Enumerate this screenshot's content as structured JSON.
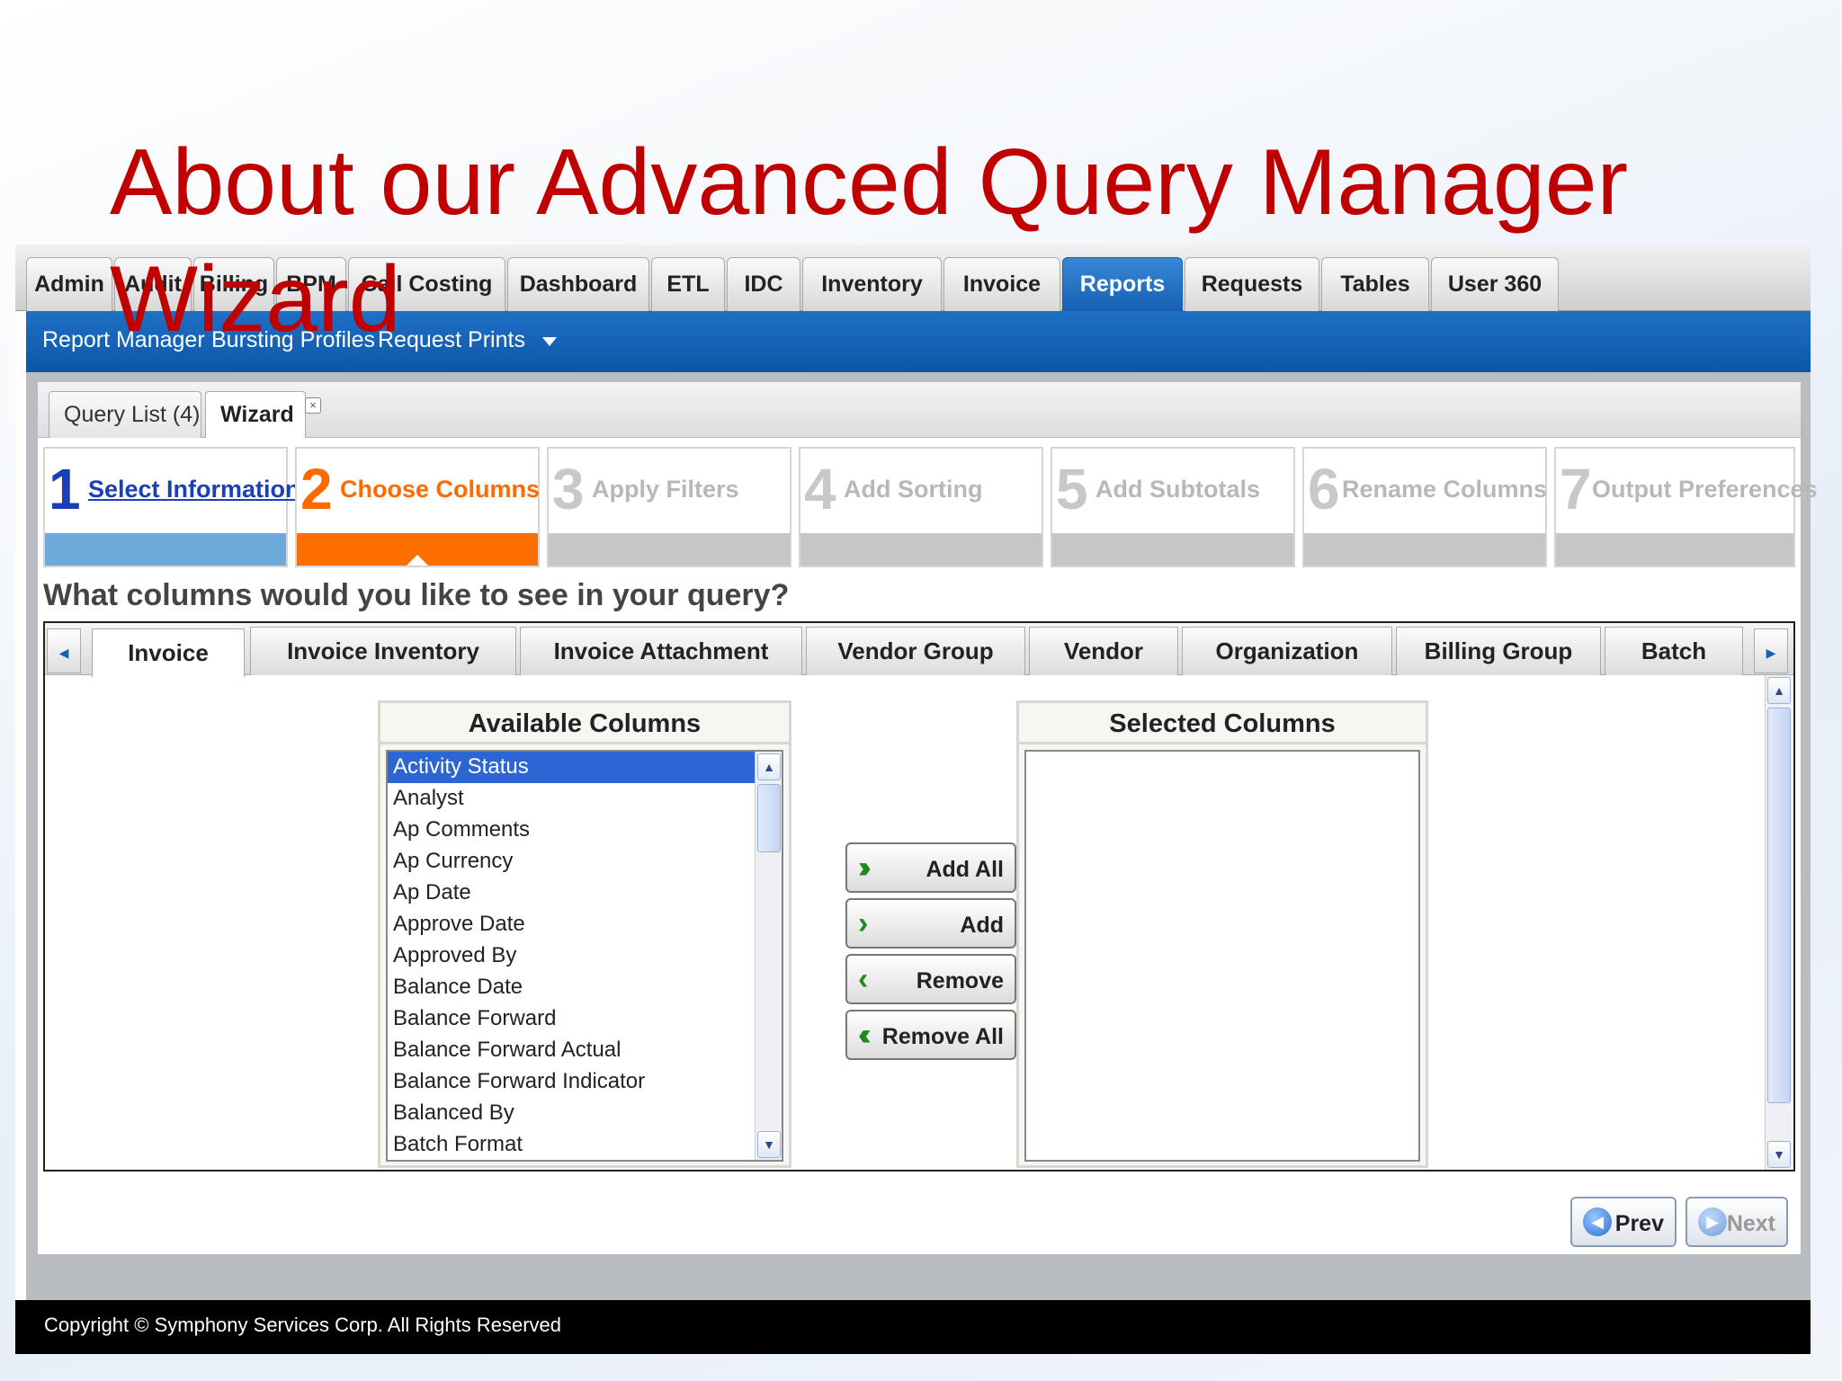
{
  "slide": {
    "title_line1": "About our Advanced Query Manager",
    "title_line2": "Wizard"
  },
  "top_tabs": [
    {
      "label": "Admin"
    },
    {
      "label": "Audit"
    },
    {
      "label": "Billing"
    },
    {
      "label": "BPM"
    },
    {
      "label": "Call Costing"
    },
    {
      "label": "Dashboard"
    },
    {
      "label": "ETL"
    },
    {
      "label": "IDC"
    },
    {
      "label": "Inventory"
    },
    {
      "label": "Invoice"
    },
    {
      "label": "Reports"
    },
    {
      "label": "Requests"
    },
    {
      "label": "Tables"
    },
    {
      "label": "User 360"
    }
  ],
  "sub_nav": [
    "Report Manager",
    "Bursting Profiles",
    "Request Prints"
  ],
  "inner_tabs": {
    "query_list": "Query List (4)",
    "wizard": "Wizard",
    "close": "×"
  },
  "steps": [
    {
      "num": "1",
      "label": "Select Information",
      "state": "done"
    },
    {
      "num": "2",
      "label": "Choose Columns",
      "state": "current"
    },
    {
      "num": "3",
      "label": "Apply Filters",
      "state": "pending"
    },
    {
      "num": "4",
      "label": "Add Sorting",
      "state": "pending"
    },
    {
      "num": "5",
      "label": "Add Subtotals",
      "state": "pending"
    },
    {
      "num": "6",
      "label": "Rename Columns",
      "state": "pending"
    },
    {
      "num": "7",
      "label": "Output Preferences",
      "state": "pending"
    }
  ],
  "question": "What columns would you like to see in your query?",
  "entity_tabs": [
    "Invoice",
    "Invoice Inventory",
    "Invoice Attachment",
    "Vendor Group",
    "Vendor",
    "Organization",
    "Billing Group",
    "Batch"
  ],
  "available": {
    "header": "Available Columns",
    "items": [
      "Activity Status",
      "Analyst",
      "Ap Comments",
      "Ap Currency",
      "Ap Date",
      "Approve Date",
      "Approved By",
      "Balance Date",
      "Balance Forward",
      "Balance Forward Actual",
      "Balance Forward Indicator",
      "Balanced By",
      "Batch Format"
    ]
  },
  "selected": {
    "header": "Selected Columns",
    "items": []
  },
  "buttons": {
    "add_all": "Add All",
    "add": "Add",
    "remove": "Remove",
    "remove_all": "Remove All",
    "prev": "Prev",
    "next": "Next"
  },
  "footer": "Copyright © Symphony Services Corp. All Rights Reserved",
  "colors": {
    "title": "#c00000",
    "nav_blue": "#1560b4",
    "step_current": "#ff6f00",
    "step_done": "#6ea9dc",
    "selection": "#2d66d2"
  }
}
